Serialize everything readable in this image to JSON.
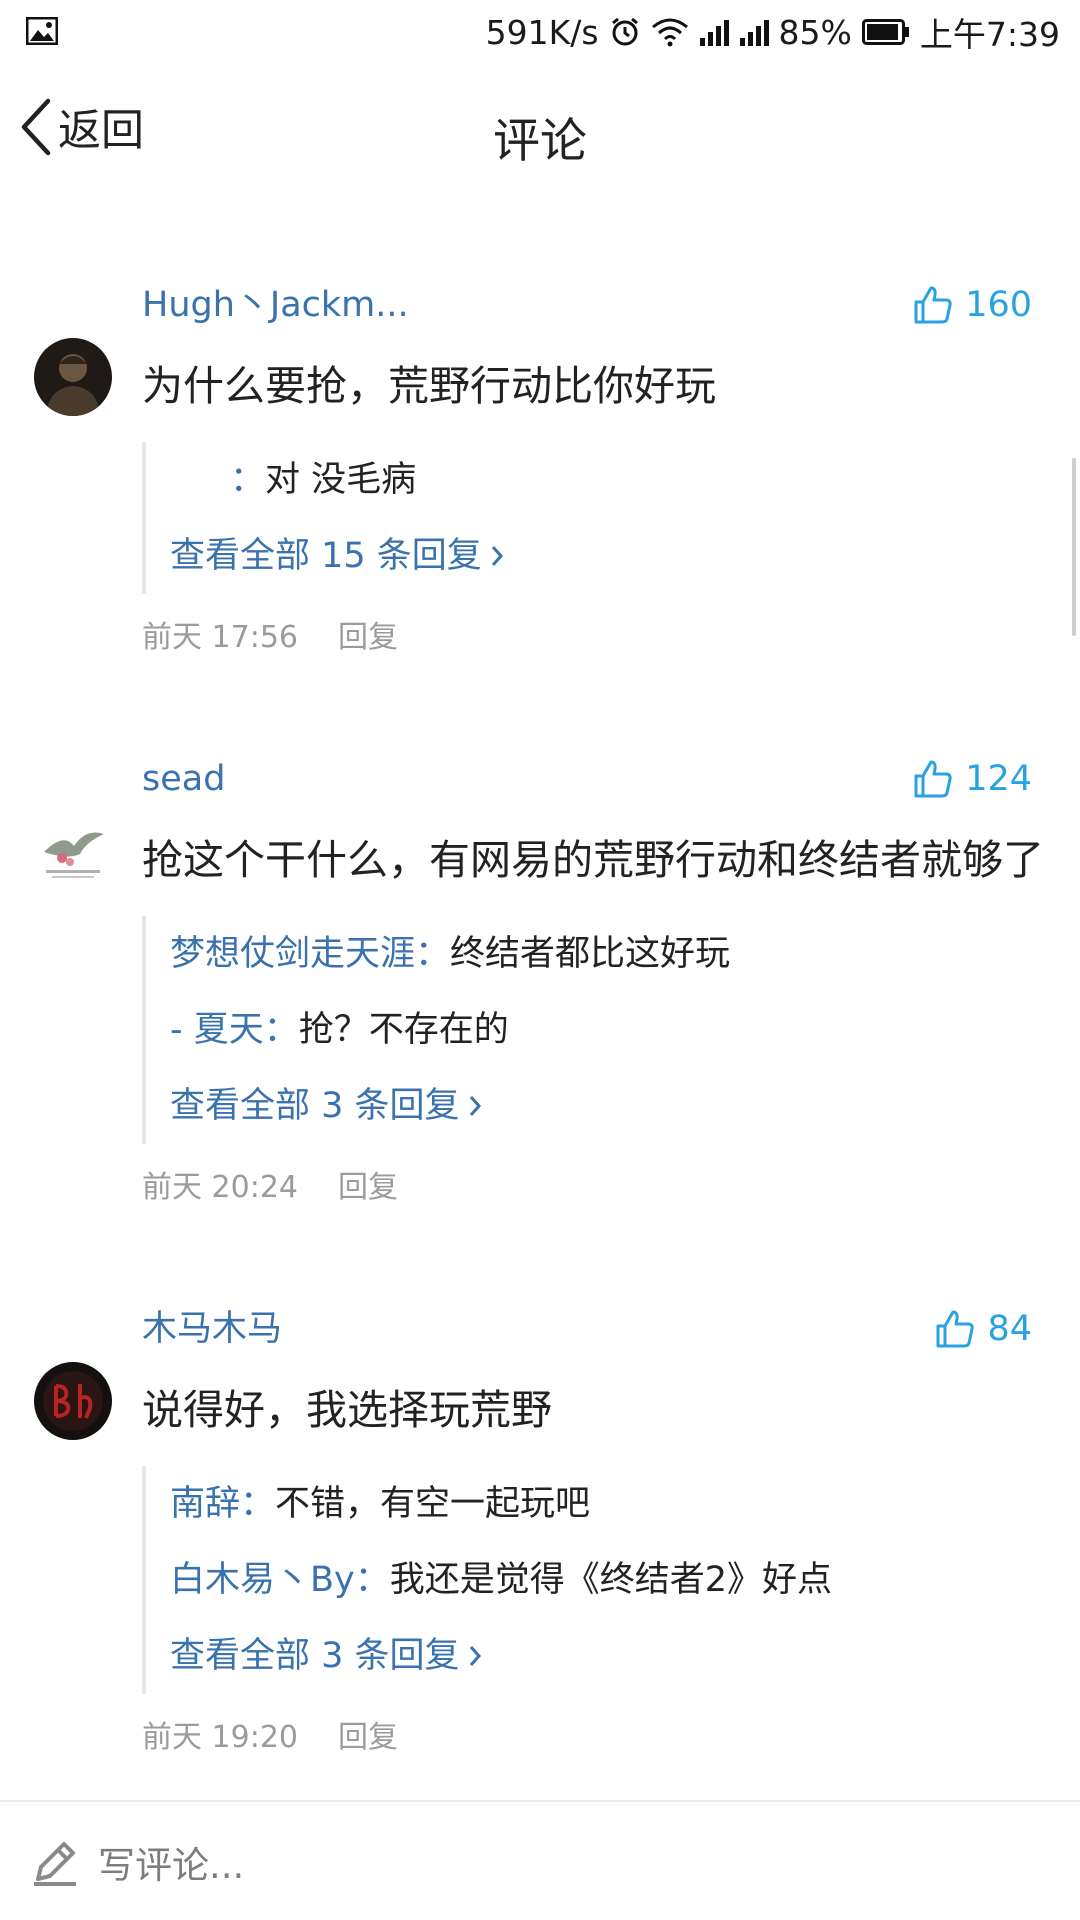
{
  "status_bar": {
    "speed": "591K/s",
    "battery_percent": "85%",
    "time": "上午7:39",
    "icons": [
      "gallery-icon",
      "alarm-icon",
      "wifi-icon",
      "signal-icon",
      "signal-icon",
      "battery-icon"
    ]
  },
  "header": {
    "back_label": "返回",
    "title": "评论"
  },
  "comments": [
    {
      "username": "Hugh丶Jackm...",
      "likes": "160",
      "text": "为什么要抢，荒野行动比你好玩",
      "replies": [
        {
          "user": "",
          "sep": "：",
          "text": "对 没毛病"
        }
      ],
      "view_all": "查看全部 15 条回复",
      "time": "前天 17:56",
      "reply_label": "回复"
    },
    {
      "username": "sead",
      "likes": "124",
      "text": "抢这个干什么，有网易的荒野行动和终结者就够了",
      "replies": [
        {
          "user": "梦想仗剑走天涯",
          "sep": "：",
          "text": "终结者都比这好玩"
        },
        {
          "user": "- 夏天",
          "sep": "：",
          "text": "抢？不存在的"
        }
      ],
      "view_all": "查看全部 3 条回复",
      "time": "前天 20:24",
      "reply_label": "回复"
    },
    {
      "username": "木马木马",
      "likes": "84",
      "text": "说得好，我选择玩荒野",
      "replies": [
        {
          "user": "南辞",
          "sep": "：",
          "text": "不错，有空一起玩吧"
        },
        {
          "user": "白木易丶By",
          "sep": "：",
          "text": "我还是觉得《终结者2》好点"
        }
      ],
      "view_all": "查看全部 3 条回复",
      "time": "前天 19:20",
      "reply_label": "回复"
    }
  ],
  "bottom_bar": {
    "placeholder": "写评论..."
  },
  "colors": {
    "username": "#3a72ad",
    "like": "#29a3e0",
    "meta": "#9b9b9b"
  }
}
